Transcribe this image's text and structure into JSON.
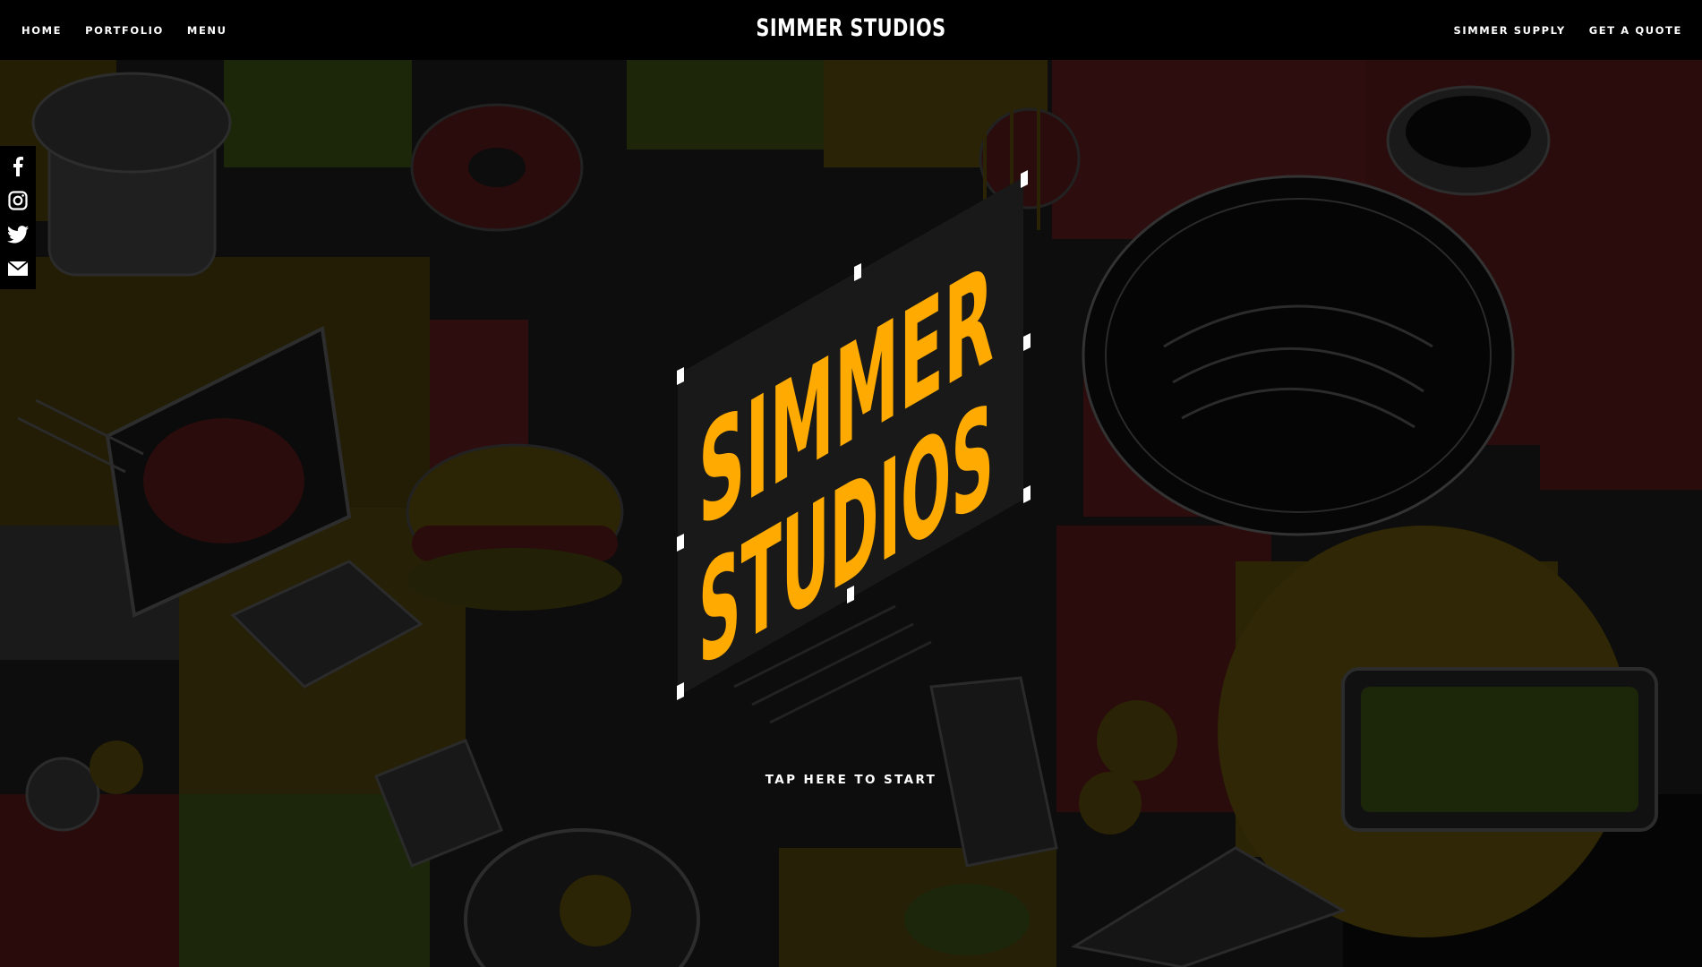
{
  "nav": {
    "left": [
      {
        "label": "HOME"
      },
      {
        "label": "PORTFOLIO"
      },
      {
        "label": "MENU"
      }
    ],
    "brand": "SIMMER STUDIOS",
    "right": [
      {
        "label": "SIMMER SUPPLY"
      },
      {
        "label": "GET A QUOTE"
      }
    ]
  },
  "social": {
    "icons": [
      "facebook-icon",
      "instagram-icon",
      "twitter-icon",
      "email-icon"
    ]
  },
  "hero": {
    "line1": "SIMMER",
    "line2": "STUDIOS",
    "color": "#FFAA00"
  },
  "cta": {
    "label": "TAP HERE TO START"
  },
  "colors": {
    "background": "#000000",
    "accent": "#FFAA00",
    "dim_yellow": "#3b3206",
    "dim_red": "#3a1010",
    "dim_green": "#1e2a0a"
  }
}
